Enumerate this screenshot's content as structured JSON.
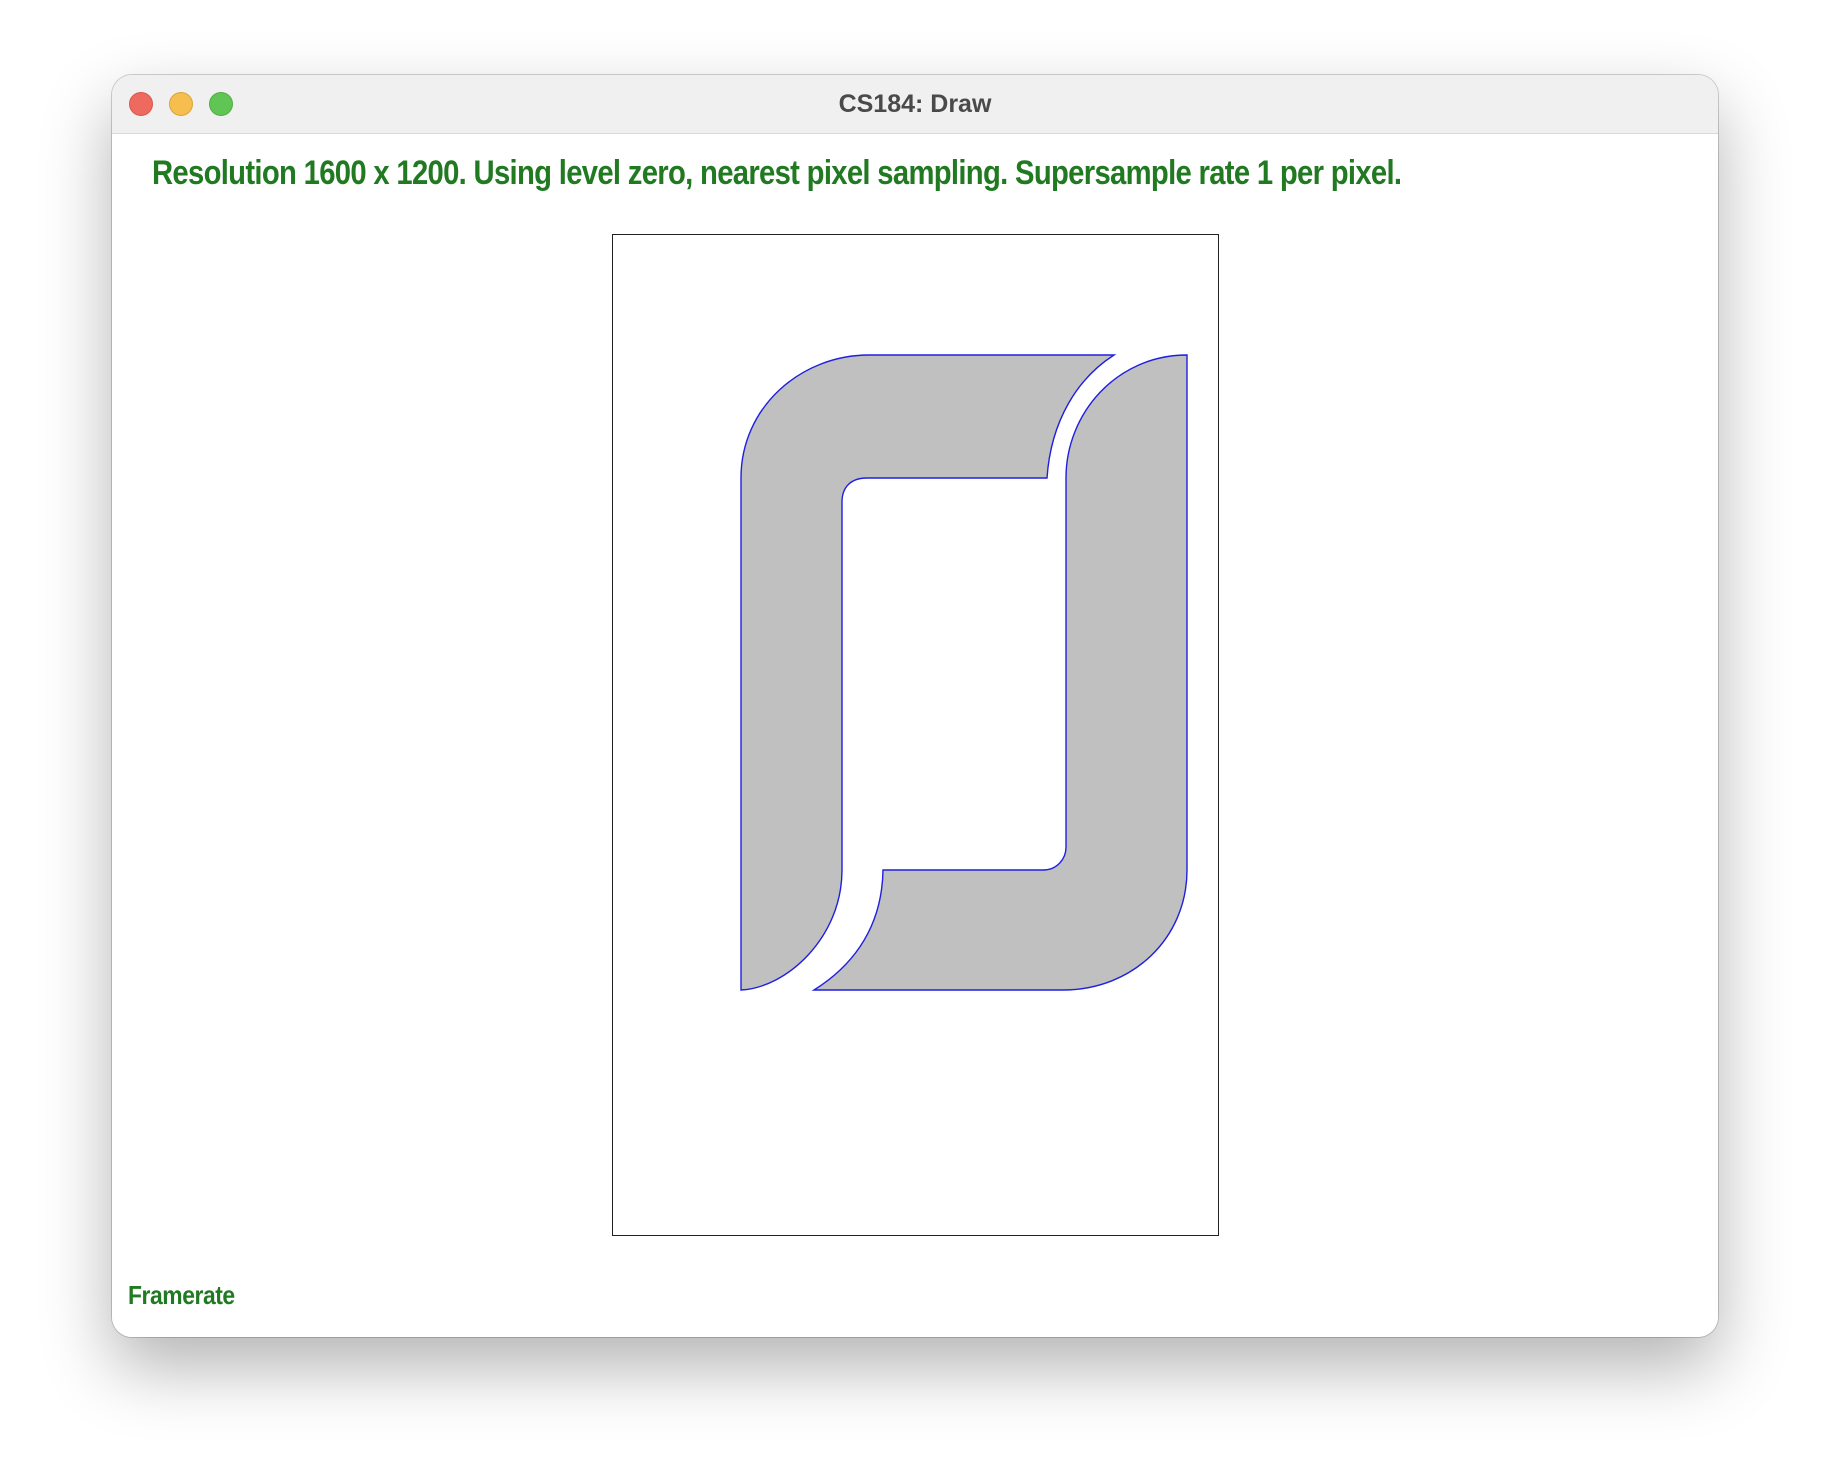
{
  "window": {
    "title": "CS184: Draw",
    "controls": {
      "close": "close-button",
      "minimize": "minimize-button",
      "maximize": "maximize-button"
    }
  },
  "status": {
    "text": "Resolution 1600 x 1200. Using level zero, nearest pixel sampling. Supersample rate 1 per pixel."
  },
  "footer": {
    "framerate_label": "Framerate"
  },
  "colors": {
    "status_text": "#217a21",
    "shape_fill": "#c0c0c0",
    "shape_stroke": "#1f1fe0",
    "canvas_border": "#222222"
  }
}
